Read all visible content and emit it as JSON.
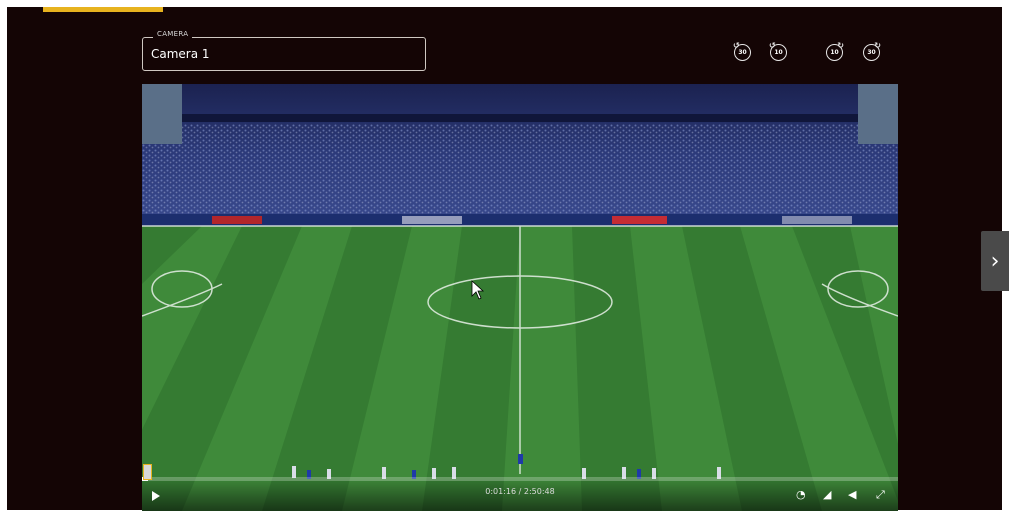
{
  "camera": {
    "label": "CAMERA",
    "value": "Camera 1"
  },
  "skip_buttons": [
    {
      "label": "30",
      "direction": "back"
    },
    {
      "label": "10",
      "direction": "back"
    },
    {
      "label": "10",
      "direction": "forward"
    },
    {
      "label": "30",
      "direction": "forward"
    }
  ],
  "player": {
    "time": "0:01:16 / 2:50:48",
    "progress": 0.0075,
    "icons": [
      "play-icon",
      "playback-speed-icon",
      "quality-icon",
      "volume-icon",
      "fullscreen-icon"
    ]
  },
  "colors": {
    "accent": "#e7b31f",
    "background": "#140505"
  }
}
